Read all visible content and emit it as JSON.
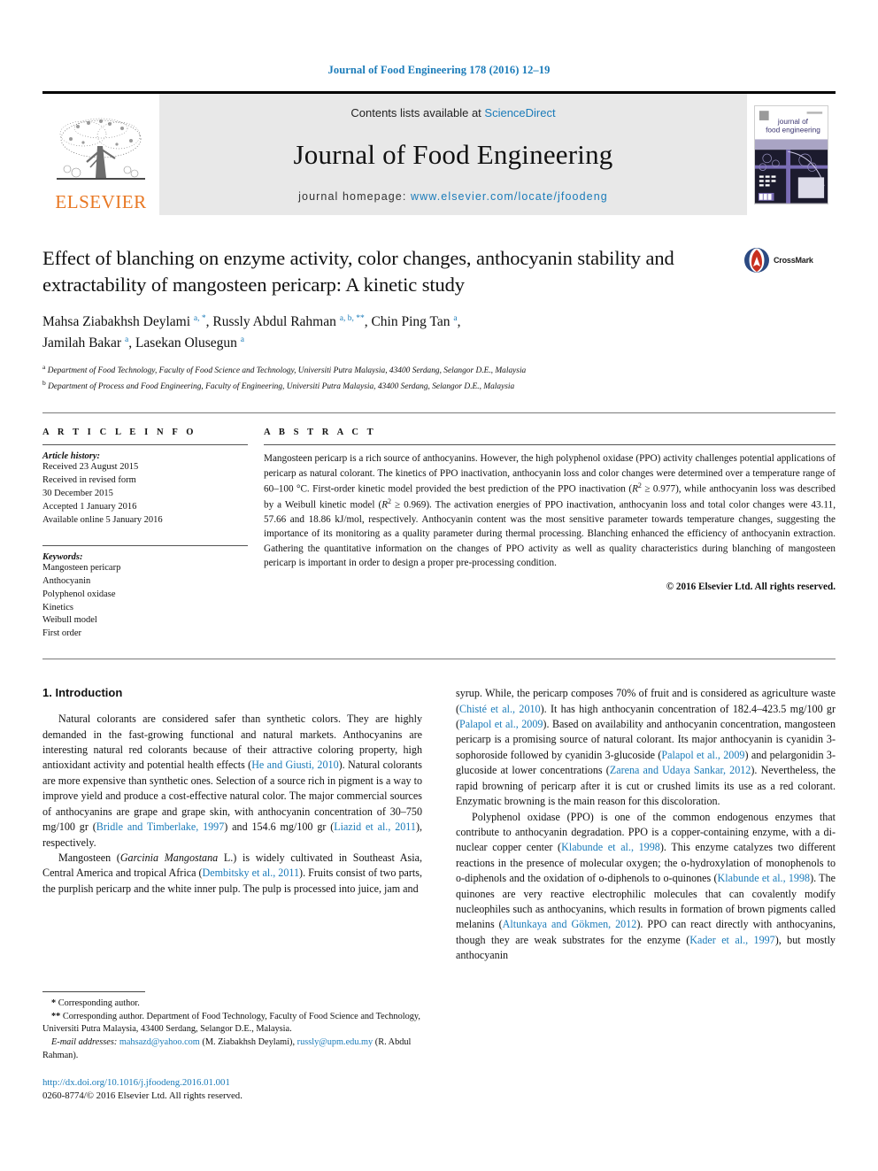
{
  "running_head": "Journal of Food Engineering 178 (2016) 12–19",
  "masthead": {
    "publisher_logo_text": "ELSEVIER",
    "contents_prefix": "Contents lists available at ",
    "contents_provider": "ScienceDirect",
    "journal_name": "Journal of Food Engineering",
    "homepage_prefix": "journal homepage: ",
    "homepage_url": "www.elsevier.com/locate/jfoodeng",
    "cover_title_line1": "journal of",
    "cover_title_line2": "food engineering"
  },
  "article": {
    "title": "Effect of blanching on enzyme activity, color changes, anthocyanin stability and extractability of mangosteen pericarp: A kinetic study",
    "crossmark_label": "CrossMark",
    "authors_line1_a": "Mahsa Ziabakhsh Deylami ",
    "authors_line1_sup1": "a, *",
    "authors_line1_b": ", Russly Abdul Rahman ",
    "authors_line1_sup2": "a, b, **",
    "authors_line1_c": ", Chin Ping Tan ",
    "authors_line1_sup3": "a",
    "authors_line1_d": ",",
    "authors_line2_a": "Jamilah Bakar ",
    "authors_line2_sup1": "a",
    "authors_line2_b": ", Lasekan Olusegun ",
    "authors_line2_sup2": "a",
    "affiliation_a_marker": "a",
    "affiliation_a": "Department of Food Technology, Faculty of Food Science and Technology, Universiti Putra Malaysia, 43400 Serdang, Selangor D.E., Malaysia",
    "affiliation_b_marker": "b",
    "affiliation_b": "Department of Process and Food Engineering, Faculty of Engineering, Universiti Putra Malaysia, 43400 Serdang, Selangor D.E., Malaysia"
  },
  "article_info": {
    "heading": "A R T I C L E   I N F O",
    "history_label": "Article history:",
    "history_lines": [
      "Received 23 August 2015",
      "Received in revised form",
      "30 December 2015",
      "Accepted 1 January 2016",
      "Available online 5 January 2016"
    ],
    "keywords_label": "Keywords:",
    "keywords": [
      "Mangosteen pericarp",
      "Anthocyanin",
      "Polyphenol oxidase",
      "Kinetics",
      "Weibull model",
      "First order"
    ]
  },
  "abstract": {
    "heading": "A B S T R A C T",
    "part1": "Mangosteen pericarp is a rich source of anthocyanins. However, the high polyphenol oxidase (PPO) activity challenges potential applications of pericarp as natural colorant. The kinetics of PPO inactivation, anthocyanin loss and color changes were determined over a temperature range of 60–100 °C. First-order kinetic model provided the best prediction of the PPO inactivation (",
    "r_italic_1": "R",
    "r_sup_1": "2",
    "part2": " ≥ 0.977), while anthocyanin loss was described by a Weibull kinetic model (",
    "r_italic_2": "R",
    "r_sup_2": "2",
    "part3": " ≥ 0.969). The activation energies of PPO inactivation, anthocyanin loss and total color changes were 43.11, 57.66 and 18.86 kJ/mol, respectively. Anthocyanin content was the most sensitive parameter towards temperature changes, suggesting the importance of its monitoring as a quality parameter during thermal processing. Blanching enhanced the efficiency of anthocyanin extraction. Gathering the quantitative information on the changes of PPO activity as well as quality characteristics during blanching of mangosteen pericarp is important in order to design a proper pre-processing condition.",
    "copyright": "© 2016 Elsevier Ltd. All rights reserved."
  },
  "introduction": {
    "heading": "1. Introduction",
    "left_p1_a": "Natural colorants are considered safer than synthetic colors. They are highly demanded in the fast-growing functional and natural markets. Anthocyanins are interesting natural red colorants because of their attractive coloring property, high antioxidant activity and potential health effects (",
    "left_p1_ref1": "He and Giusti, 2010",
    "left_p1_b": "). Natural colorants are more expensive than synthetic ones. Selection of a source rich in pigment is a way to improve yield and produce a cost-effective natural color. The major commercial sources of anthocyanins are grape and grape skin, with anthocyanin concentration of 30–750 mg/100 gr (",
    "left_p1_ref2": "Bridle and Timberlake, 1997",
    "left_p1_c": ") and 154.6 mg/100 gr (",
    "left_p1_ref3": "Liazid et al., 2011",
    "left_p1_d": "), respectively.",
    "left_p2_a": "Mangosteen (",
    "left_p2_italic": "Garcinia Mangostana",
    "left_p2_b": " L.) is widely cultivated in Southeast Asia, Central America and tropical Africa (",
    "left_p2_ref1": "Dembitsky et al., 2011",
    "left_p2_c": "). Fruits consist of two parts, the purplish pericarp and the white inner pulp. The pulp is processed into juice, jam and",
    "right_p1_a": "syrup. While, the pericarp composes 70% of fruit and is considered as agriculture waste (",
    "right_p1_ref1": "Chisté et al., 2010",
    "right_p1_b": "). It has high anthocyanin concentration of 182.4–423.5 mg/100 gr (",
    "right_p1_ref2": "Palapol et al., 2009",
    "right_p1_c": "). Based on availability and anthocyanin concentration, mangosteen pericarp is a promising source of natural colorant. Its major anthocyanin is cyanidin 3-sophoroside followed by cyanidin 3-glucoside (",
    "right_p1_ref3": "Palapol et al., 2009",
    "right_p1_d": ") and pelargonidin 3-glucoside at lower concentrations (",
    "right_p1_ref4": "Zarena and Udaya Sankar, 2012",
    "right_p1_e": "). Nevertheless, the rapid browning of pericarp after it is cut or crushed limits its use as a red colorant. Enzymatic browning is the main reason for this discoloration.",
    "right_p2_a": "Polyphenol oxidase (PPO) is one of the common endogenous enzymes that contribute to anthocyanin degradation. PPO is a copper-containing enzyme, with a di-nuclear copper center (",
    "right_p2_ref1": "Klabunde et al., 1998",
    "right_p2_b": "). This enzyme catalyzes two different reactions in the presence of molecular oxygen; the o-hydroxylation of monophenols to o-diphenols and the oxidation of o-diphenols to o-quinones (",
    "right_p2_ref2": "Klabunde et al., 1998",
    "right_p2_c": "). The quinones are very reactive electrophilic molecules that can covalently modify nucleophiles such as anthocyanins, which results in formation of brown pigments called melanins (",
    "right_p2_ref3": "Altunkaya and Gökmen, 2012",
    "right_p2_d": "). PPO can react directly with anthocyanins, though they are weak substrates for the enzyme (",
    "right_p2_ref4": "Kader et al., 1997",
    "right_p2_e": "), but mostly anthocyanin"
  },
  "footnotes": {
    "star_marker": "*",
    "star_text": " Corresponding author.",
    "dstar_marker": "**",
    "dstar_text": " Corresponding author. Department of Food Technology, Faculty of Food Science and Technology, Universiti Putra Malaysia, 43400 Serdang, Selangor D.E., Malaysia.",
    "email_label": "E-mail addresses:",
    "email1": "mahsazd@yahoo.com",
    "email1_owner": " (M. Ziabakhsh Deylami), ",
    "email2": "russly@upm.edu.my",
    "email2_owner": " (R. Abdul Rahman).",
    "doi": "http://dx.doi.org/10.1016/j.jfoodeng.2016.01.001",
    "issn_line": "0260-8774/© 2016 Elsevier Ltd. All rights reserved."
  },
  "colors": {
    "link_blue": "#1a7bb9",
    "elsevier_orange": "#E87722",
    "masthead_gray": "#e8e8e8",
    "cover_purple": "#6b5ea8"
  }
}
